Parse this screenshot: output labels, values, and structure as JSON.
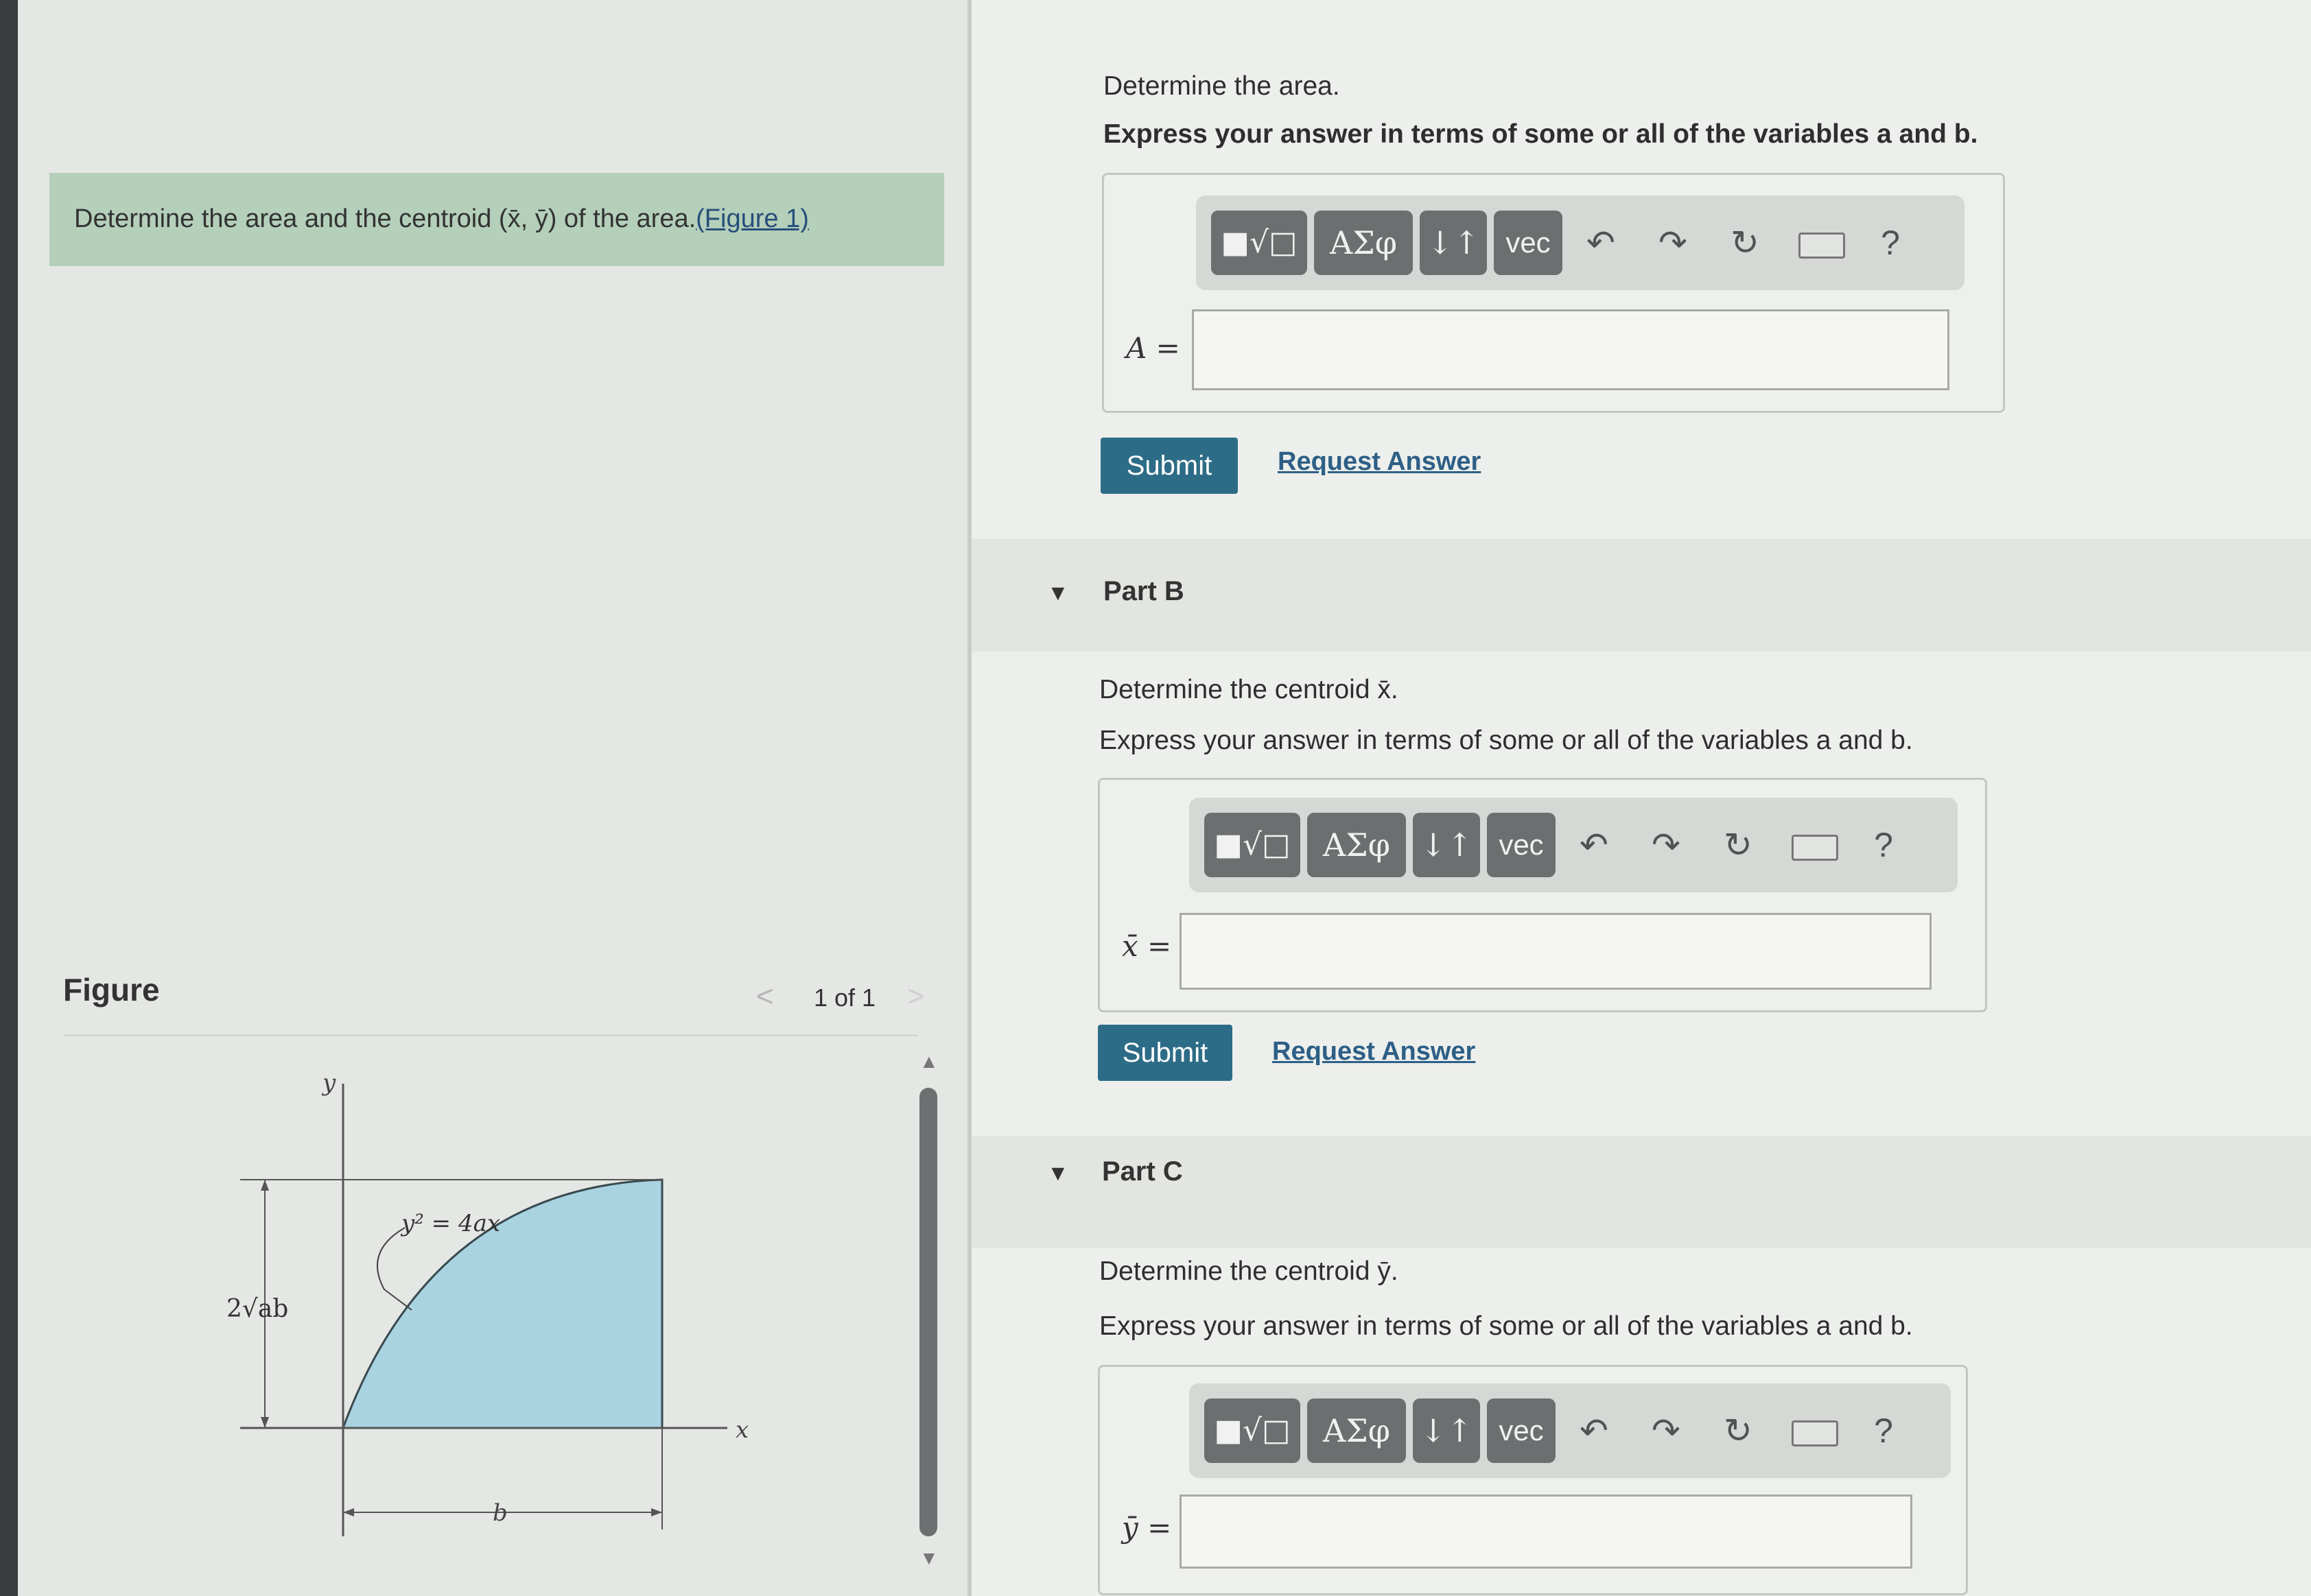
{
  "problem": {
    "statement": "Determine the area and the centroid (x̄, ȳ) of the area.",
    "figure_link": "(Figure 1)"
  },
  "figure": {
    "title": "Figure",
    "pager": "1 of 1",
    "prev_icon": "chevron-left-icon",
    "next_icon": "chevron-right-icon",
    "labels": {
      "y_axis": "y",
      "x_axis": "x",
      "equation": "y² = 4ax",
      "height": "2√ab",
      "width": "b"
    },
    "fill_color": "#a9d3e1"
  },
  "toolbar": {
    "buttons": [
      "■√□",
      "ΑΣφ",
      "↓↑",
      "vec"
    ],
    "icons": [
      "undo-icon",
      "redo-icon",
      "reset-icon",
      "keyboard-icon",
      "help-icon"
    ],
    "help_label": "?"
  },
  "part_a": {
    "prompt": "Determine the area.",
    "instruction": "Express your answer in terms of some or all of the variables a and b.",
    "answer_label": "A =",
    "answer_value": "",
    "submit_label": "Submit",
    "request_label": "Request Answer"
  },
  "part_b": {
    "title": "Part B",
    "prompt": "Determine the centroid x̄.",
    "instruction": "Express your answer in terms of some or all of the variables a and b.",
    "answer_label": "x̄ =",
    "answer_value": "",
    "submit_label": "Submit",
    "request_label": "Request Answer"
  },
  "part_c": {
    "title": "Part C",
    "prompt": "Determine the centroid ȳ.",
    "instruction": "Express your answer in terms of some or all of the variables a and b.",
    "answer_label": "ȳ =",
    "answer_value": ""
  },
  "colors": {
    "submit": "#2d6c86",
    "banner": "#b4cfba",
    "toolbar_button": "#6b6f70"
  }
}
